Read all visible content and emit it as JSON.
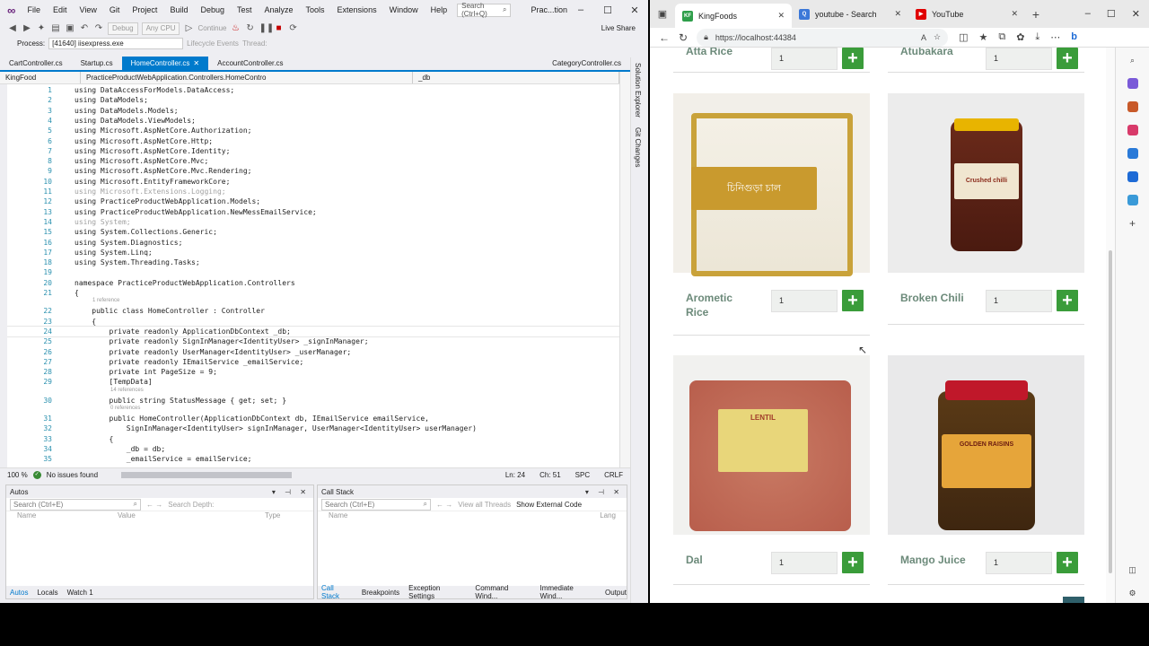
{
  "vs": {
    "menu": [
      "File",
      "Edit",
      "View",
      "Git",
      "Project",
      "Build",
      "Debug",
      "Test",
      "Analyze",
      "Tools",
      "Extensions",
      "Window",
      "Help"
    ],
    "search_placeholder": "Search (Ctrl+Q)",
    "solution": "Prac...tion",
    "toolbar": {
      "config": "Debug",
      "platform": "Any CPU",
      "continue": "Continue",
      "live_share": "Live Share"
    },
    "process": {
      "label": "Process:",
      "value": "[41640] iisexpress.exe",
      "lifecycle": "Lifecycle Events",
      "thread": "Thread:"
    },
    "tabs": [
      "CartController.cs",
      "Startup.cs",
      "HomeController.cs",
      "AccountController.cs"
    ],
    "active_tab": "HomeController.cs",
    "right_tab": "CategoryController.cs",
    "nav": {
      "project": "KingFood",
      "class": "PracticeProductWebApplication.Controllers.HomeContro",
      "member": "_db"
    },
    "code_lines": [
      {
        "n": "1",
        "t": "using DataAccessForModels.DataAccess;"
      },
      {
        "n": "2",
        "t": "using DataModels;"
      },
      {
        "n": "3",
        "t": "using DataModels.Models;"
      },
      {
        "n": "4",
        "t": "using DataModels.ViewModels;"
      },
      {
        "n": "5",
        "t": "using Microsoft.AspNetCore.Authorization;"
      },
      {
        "n": "6",
        "t": "using Microsoft.AspNetCore.Http;"
      },
      {
        "n": "7",
        "t": "using Microsoft.AspNetCore.Identity;"
      },
      {
        "n": "8",
        "t": "using Microsoft.AspNetCore.Mvc;"
      },
      {
        "n": "9",
        "t": "using Microsoft.AspNetCore.Mvc.Rendering;"
      },
      {
        "n": "10",
        "t": "using Microsoft.EntityFrameworkCore;"
      },
      {
        "n": "11",
        "t": "using Microsoft.Extensions.Logging;"
      },
      {
        "n": "12",
        "t": "using PracticeProductWebApplication.Models;"
      },
      {
        "n": "13",
        "t": "using PracticeProductWebApplication.NewMessEmailService;"
      },
      {
        "n": "14",
        "t": "using System;"
      },
      {
        "n": "15",
        "t": "using System.Collections.Generic;"
      },
      {
        "n": "16",
        "t": "using System.Diagnostics;"
      },
      {
        "n": "17",
        "t": "using System.Linq;"
      },
      {
        "n": "18",
        "t": "using System.Threading.Tasks;"
      },
      {
        "n": "19",
        "t": ""
      },
      {
        "n": "20",
        "t": "namespace PracticeProductWebApplication.Controllers"
      },
      {
        "n": "21",
        "t": "{"
      },
      {
        "n": "22",
        "t": "    public class HomeController : Controller"
      },
      {
        "n": "23",
        "t": "    {"
      },
      {
        "n": "24",
        "t": "        private readonly ApplicationDbContext _db;"
      },
      {
        "n": "25",
        "t": "        private readonly SignInManager<IdentityUser> _signInManager;"
      },
      {
        "n": "26",
        "t": "        private readonly UserManager<IdentityUser> _userManager;"
      },
      {
        "n": "27",
        "t": "        private readonly IEmailService _emailService;"
      },
      {
        "n": "28",
        "t": "        private int PageSize = 9;"
      },
      {
        "n": "29",
        "t": "        [TempData]"
      },
      {
        "n": "30",
        "t": "        public string StatusMessage { get; set; }"
      },
      {
        "n": "31",
        "t": "        public HomeController(ApplicationDbContext db, IEmailService emailService,"
      },
      {
        "n": "32",
        "t": "            SignInManager<IdentityUser> signInManager, UserManager<IdentityUser> userManager)"
      },
      {
        "n": "33",
        "t": "        {"
      },
      {
        "n": "34",
        "t": "            _db = db;"
      },
      {
        "n": "35",
        "t": "            _emailService = emailService;"
      }
    ],
    "refs": {
      "r1": "1 reference",
      "r14": "14 references",
      "r0": "0 references"
    },
    "status": {
      "zoom": "100 %",
      "issues": "No issues found",
      "ln": "Ln: 24",
      "ch": "Ch: 51",
      "spc": "SPC",
      "crlf": "CRLF"
    },
    "autos": {
      "title": "Autos",
      "search": "Search (Ctrl+E)",
      "depth": "Search Depth:",
      "cols": [
        "Name",
        "Value",
        "Type"
      ],
      "tabs": [
        "Autos",
        "Locals",
        "Watch 1"
      ]
    },
    "callstack": {
      "title": "Call Stack",
      "search": "Search (Ctrl+E)",
      "threads": "View all Threads",
      "external": "Show External Code",
      "cols": [
        "Name",
        "Lang"
      ],
      "tabs": [
        "Call Stack",
        "Breakpoints",
        "Exception Settings",
        "Command Wind...",
        "Immediate Wind...",
        "Output"
      ]
    },
    "side": {
      "solution": "Solution Explorer",
      "git": "Git Changes"
    }
  },
  "browser": {
    "tabs": [
      {
        "label": "KingFoods",
        "icon": "KF",
        "color": "#2e9e4a"
      },
      {
        "label": "youtube - Search",
        "icon": "Q",
        "color": "#3c78d8"
      },
      {
        "label": "YouTube",
        "icon": "▶",
        "color": "#e00000"
      }
    ],
    "url": "https://localhost:44384",
    "top_cards": [
      {
        "name": "Atta Rice",
        "qty": "1"
      },
      {
        "name": "Atubakara",
        "qty": "1"
      }
    ],
    "products": [
      {
        "name": "Arometic Rice",
        "qty": "1",
        "label": "চিনিগুড়া চাল"
      },
      {
        "name": "Broken Chili",
        "qty": "1",
        "label": "Crushed chilli"
      },
      {
        "name": "Dal",
        "qty": "1",
        "label": "LENTIL"
      },
      {
        "name": "Mango Juice",
        "qty": "1",
        "label": "GOLDEN RAISINS"
      }
    ]
  }
}
